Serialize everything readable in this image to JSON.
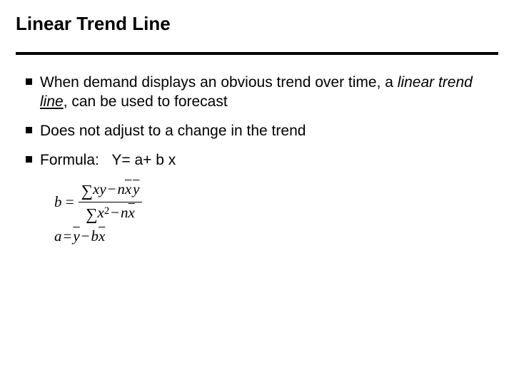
{
  "title": "Linear Trend Line",
  "bullets": {
    "b1": {
      "pre": "When demand displays an obvious trend over time, a ",
      "italic_part": "linear trend ",
      "underline_part": "line",
      "post": ", can be used to forecast"
    },
    "b2": "Does not adjust to a change in the trend",
    "b3": {
      "label": "Formula:",
      "eq": "Y= a+ b x"
    }
  },
  "formulas": {
    "b_lhs": "b",
    "equals": "=",
    "sigma": "∑",
    "xy": "xy",
    "minus": "−",
    "n": "n",
    "xbar": "x",
    "ybar": "y",
    "x": "x",
    "sq": "2",
    "a_lhs": "a",
    "b_var": "b"
  }
}
